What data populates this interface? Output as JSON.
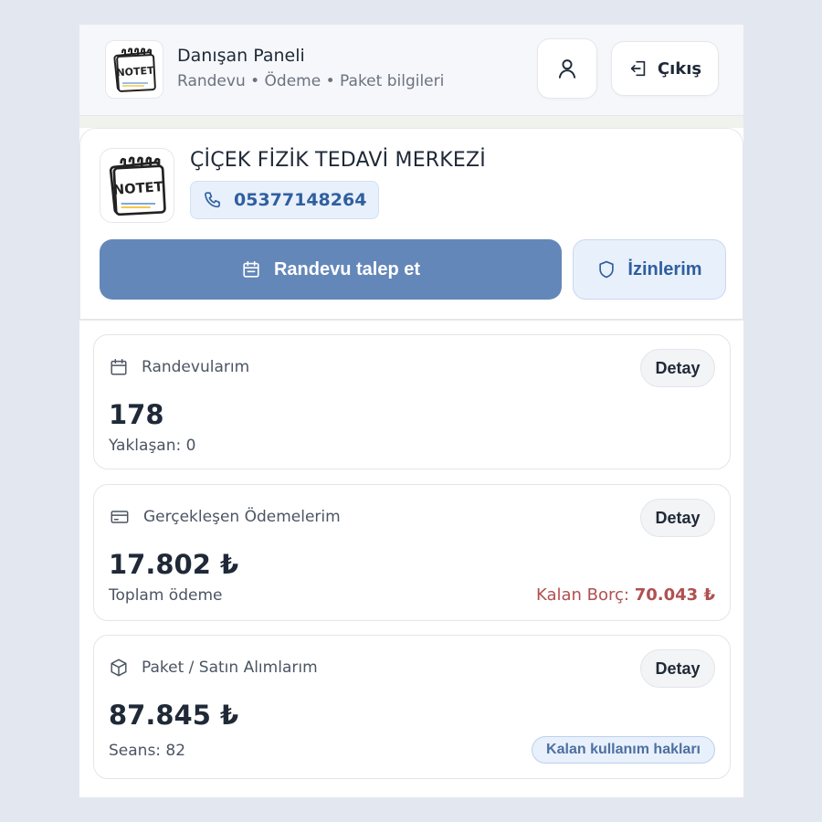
{
  "header": {
    "title": "Danışan Paneli",
    "subtitle": "Randevu • Ödeme • Paket bilgileri",
    "logout_label": "Çıkış",
    "logo_text": "NOTET"
  },
  "clinic": {
    "name": "ÇİÇEK FİZİK TEDAVİ MERKEZİ",
    "phone": "05377148264",
    "request_label": "Randevu talep et",
    "permissions_label": "İzinlerim"
  },
  "cards": {
    "appointments": {
      "title": "Randevularım",
      "detail_label": "Detay",
      "value": "178",
      "sub_label": "Yaklaşan: 0"
    },
    "payments": {
      "title": "Gerçekleşen Ödemelerim",
      "detail_label": "Detay",
      "value": "17.802 ₺",
      "sub_label": "Toplam ödeme",
      "debt_label": "Kalan Borç:",
      "debt_value": "70.043 ₺"
    },
    "packages": {
      "title": "Paket / Satın Alımlarım",
      "detail_label": "Detay",
      "value": "87.845 ₺",
      "sub_label": "Seans: 82",
      "remaining_label": "Kalan kullanım hakları"
    }
  },
  "colors": {
    "primary": "#6487b9",
    "accent_text": "#2f5f9e",
    "debt": "#b05050",
    "background": "#e3e8f0"
  }
}
